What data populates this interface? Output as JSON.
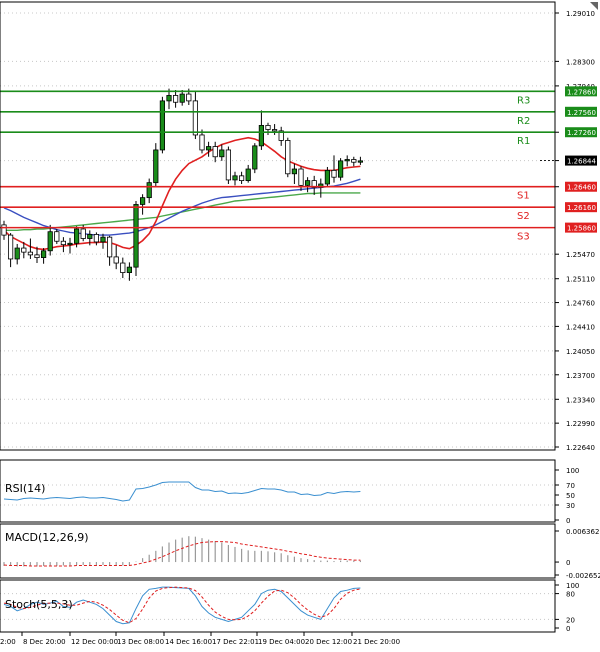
{
  "chart_data": [
    {
      "type": "candlestick",
      "panel": "price",
      "y_ticks": [
        "1.29010",
        "1.28300",
        "1.27940",
        "1.27260",
        "1.26844",
        "1.26460",
        "1.25470",
        "1.25110",
        "1.24760",
        "1.24410",
        "1.24050",
        "1.23700",
        "1.23340",
        "1.22990",
        "1.22640"
      ],
      "levels": [
        {
          "label": "R3",
          "value": 1.2786,
          "tag": "1.27860",
          "color": "#1a8c1a"
        },
        {
          "label": "R2",
          "value": 1.2756,
          "tag": "1.27560",
          "color": "#1a8c1a"
        },
        {
          "label": "R1",
          "value": 1.2726,
          "tag": "1.27260",
          "color": "#1a8c1a"
        },
        {
          "label": "S1",
          "value": 1.2646,
          "tag": "1.26460",
          "color": "#e02020"
        },
        {
          "label": "S2",
          "value": 1.2616,
          "tag": "1.26160",
          "color": "#e02020"
        },
        {
          "label": "S3",
          "value": 1.2586,
          "tag": "1.25860",
          "color": "#e02020"
        }
      ],
      "current_price": {
        "value": 1.26844,
        "tag": "1.26844"
      },
      "candles": [
        [
          1.259,
          1.2596,
          1.2568,
          1.2575
        ],
        [
          1.2575,
          1.2578,
          1.2528,
          1.254
        ],
        [
          1.254,
          1.2562,
          1.2532,
          1.2556
        ],
        [
          1.2556,
          1.2565,
          1.2541,
          1.255
        ],
        [
          1.255,
          1.257,
          1.254,
          1.2546
        ],
        [
          1.2546,
          1.2558,
          1.2534,
          1.2542
        ],
        [
          1.2542,
          1.2556,
          1.2533,
          1.2552
        ],
        [
          1.2552,
          1.259,
          1.2545,
          1.258
        ],
        [
          1.258,
          1.2584,
          1.2562,
          1.2566
        ],
        [
          1.2566,
          1.2572,
          1.255,
          1.2561
        ],
        [
          1.2561,
          1.2571,
          1.2548,
          1.2563
        ],
        [
          1.2563,
          1.2588,
          1.2557,
          1.2584
        ],
        [
          1.2584,
          1.259,
          1.2566,
          1.257
        ],
        [
          1.257,
          1.2582,
          1.256,
          1.2576
        ],
        [
          1.2576,
          1.2579,
          1.256,
          1.2565
        ],
        [
          1.2565,
          1.2577,
          1.2555,
          1.2572
        ],
        [
          1.2572,
          1.2574,
          1.253,
          1.2543
        ],
        [
          1.2543,
          1.256,
          1.2525,
          1.2534
        ],
        [
          1.2534,
          1.2542,
          1.2512,
          1.252
        ],
        [
          1.252,
          1.2535,
          1.2508,
          1.2528
        ],
        [
          1.2528,
          1.2625,
          1.2515,
          1.262
        ],
        [
          1.262,
          1.2635,
          1.2605,
          1.263
        ],
        [
          1.263,
          1.2658,
          1.2622,
          1.2652
        ],
        [
          1.2652,
          1.271,
          1.2645,
          1.27
        ],
        [
          1.27,
          1.2778,
          1.2695,
          1.2772
        ],
        [
          1.2772,
          1.279,
          1.276,
          1.278
        ],
        [
          1.278,
          1.2788,
          1.2762,
          1.277
        ],
        [
          1.277,
          1.2788,
          1.2765,
          1.2782
        ],
        [
          1.2782,
          1.279,
          1.2766,
          1.2772
        ],
        [
          1.2772,
          1.2785,
          1.2716,
          1.2722
        ],
        [
          1.2722,
          1.273,
          1.2695,
          1.27
        ],
        [
          1.27,
          1.2712,
          1.269,
          1.2705
        ],
        [
          1.2705,
          1.2712,
          1.2682,
          1.269
        ],
        [
          1.269,
          1.2708,
          1.2684,
          1.27
        ],
        [
          1.27,
          1.2705,
          1.265,
          1.2656
        ],
        [
          1.2656,
          1.2668,
          1.2648,
          1.2662
        ],
        [
          1.2662,
          1.2668,
          1.265,
          1.2655
        ],
        [
          1.2655,
          1.2678,
          1.2652,
          1.2672
        ],
        [
          1.2672,
          1.271,
          1.2666,
          1.2706
        ],
        [
          1.2706,
          1.2758,
          1.27,
          1.2736
        ],
        [
          1.2736,
          1.274,
          1.2722,
          1.273
        ],
        [
          1.273,
          1.2738,
          1.2722,
          1.2728
        ],
        [
          1.2728,
          1.2734,
          1.2706,
          1.2714
        ],
        [
          1.2714,
          1.2718,
          1.266,
          1.2665
        ],
        [
          1.2665,
          1.268,
          1.265,
          1.2672
        ],
        [
          1.2672,
          1.2676,
          1.264,
          1.2648
        ],
        [
          1.2648,
          1.266,
          1.2638,
          1.2655
        ],
        [
          1.2655,
          1.2662,
          1.2634,
          1.2645
        ],
        [
          1.2645,
          1.2658,
          1.263,
          1.265
        ],
        [
          1.265,
          1.2675,
          1.2645,
          1.267
        ],
        [
          1.267,
          1.2692,
          1.2652,
          1.266
        ],
        [
          1.266,
          1.2688,
          1.2655,
          1.2684
        ],
        [
          1.2684,
          1.2692,
          1.2676,
          1.2686
        ],
        [
          1.2686,
          1.269,
          1.2676,
          1.2682
        ],
        [
          1.2682,
          1.269,
          1.2678,
          1.2684
        ]
      ],
      "ma_red": [
        1.2582,
        1.2573,
        1.2568,
        1.2563,
        1.2558,
        1.2555,
        1.2554,
        1.2556,
        1.2558,
        1.2559,
        1.256,
        1.2562,
        1.2563,
        1.2564,
        1.2564,
        1.2565,
        1.2564,
        1.2561,
        1.2557,
        1.2555,
        1.256,
        1.2567,
        1.2577,
        1.2595,
        1.2618,
        1.264,
        1.2657,
        1.267,
        1.268,
        1.2685,
        1.269,
        1.2697,
        1.2703,
        1.2708,
        1.2711,
        1.2714,
        1.2716,
        1.2718,
        1.2716,
        1.2712,
        1.2705,
        1.2698,
        1.269,
        1.2684,
        1.268,
        1.2676,
        1.2673,
        1.2671,
        1.267,
        1.267,
        1.267,
        1.2672,
        1.2674,
        1.2675,
        1.2676
      ],
      "ma_blue": [
        1.2615,
        1.2611,
        1.2606,
        1.2601,
        1.2597,
        1.2593,
        1.2589,
        1.2586,
        1.2583,
        1.2581,
        1.2579,
        1.2578,
        1.2577,
        1.2576,
        1.2575,
        1.2575,
        1.2575,
        1.2576,
        1.2577,
        1.2578,
        1.258,
        1.2583,
        1.2586,
        1.259,
        1.2595,
        1.26,
        1.2605,
        1.261,
        1.2614,
        1.2618,
        1.2622,
        1.2625,
        1.2628,
        1.263,
        1.2631,
        1.2632,
        1.2633,
        1.2634,
        1.2635,
        1.2636,
        1.2637,
        1.2638,
        1.2639,
        1.264,
        1.2641,
        1.2642,
        1.2643,
        1.2644,
        1.2645,
        1.2646,
        1.2647,
        1.2649,
        1.2651,
        1.2654,
        1.2657
      ],
      "ma_green": [
        1.2582,
        1.2582,
        1.2582,
        1.2583,
        1.2583,
        1.2584,
        1.2584,
        1.2585,
        1.2586,
        1.2587,
        1.2588,
        1.2589,
        1.259,
        1.2591,
        1.2592,
        1.2593,
        1.2594,
        1.2595,
        1.2596,
        1.2597,
        1.2598,
        1.2599,
        1.26,
        1.2601,
        1.2603,
        1.2605,
        1.2607,
        1.2609,
        1.2611,
        1.2613,
        1.2615,
        1.2617,
        1.2619,
        1.2621,
        1.2623,
        1.2625,
        1.2626,
        1.2627,
        1.2628,
        1.2629,
        1.263,
        1.2631,
        1.2632,
        1.2633,
        1.2634,
        1.2635,
        1.2636,
        1.2636,
        1.2637,
        1.2637,
        1.2637,
        1.2637,
        1.2637,
        1.2637,
        1.2637
      ]
    },
    {
      "type": "line",
      "panel": "rsi",
      "name": "RSI(14)",
      "y_ticks": [
        "100",
        "70",
        "50",
        "30",
        "0"
      ],
      "ylim": [
        0,
        100
      ],
      "values": [
        42,
        41,
        40,
        43,
        44,
        43,
        42,
        44,
        45,
        44,
        43,
        45,
        46,
        44,
        44,
        45,
        43,
        41,
        38,
        40,
        62,
        63,
        66,
        70,
        75,
        76,
        76,
        76,
        76,
        65,
        60,
        60,
        57,
        58,
        53,
        54,
        53,
        55,
        59,
        63,
        62,
        62,
        60,
        56,
        56,
        51,
        52,
        49,
        50,
        55,
        53,
        56,
        57,
        56,
        57
      ]
    },
    {
      "type": "bar",
      "panel": "macd",
      "name": "MACD(12,26,9)",
      "y_ticks": [
        "0.006362",
        "0",
        "-0.002652"
      ],
      "ylim": [
        -0.002652,
        0.006362
      ],
      "values": [
        -0.0008,
        -0.0008,
        -0.0009,
        -0.0009,
        -0.0009,
        -0.0009,
        -0.0008,
        -0.0008,
        -0.0008,
        -0.0007,
        -0.0007,
        -0.0006,
        -0.0006,
        -0.0006,
        -0.0006,
        -0.0006,
        -0.0006,
        -0.0007,
        -0.0007,
        -0.0006,
        0.0001,
        0.0008,
        0.0015,
        0.0023,
        0.0032,
        0.004,
        0.0046,
        0.005,
        0.0053,
        0.0052,
        0.0049,
        0.0046,
        0.0043,
        0.004,
        0.0035,
        0.0031,
        0.0027,
        0.0024,
        0.0023,
        0.0023,
        0.0022,
        0.002,
        0.0018,
        0.0014,
        0.0011,
        0.0008,
        0.0006,
        0.0004,
        0.0003,
        0.0003,
        0.0002,
        0.0003,
        0.0003,
        0.0003,
        0.0003
      ],
      "signal": [
        -0.0006,
        -0.0007,
        -0.0007,
        -0.0007,
        -0.0008,
        -0.0008,
        -0.0008,
        -0.0008,
        -0.0008,
        -0.0008,
        -0.0008,
        -0.0007,
        -0.0007,
        -0.0007,
        -0.0007,
        -0.0007,
        -0.0007,
        -0.0007,
        -0.0007,
        -0.0007,
        -0.0005,
        -0.0002,
        0.0001,
        0.0006,
        0.0011,
        0.0017,
        0.0023,
        0.0028,
        0.0033,
        0.0037,
        0.004,
        0.0041,
        0.0042,
        0.0042,
        0.0041,
        0.004,
        0.0037,
        0.0035,
        0.0033,
        0.0031,
        0.0029,
        0.0027,
        0.0025,
        0.0022,
        0.002,
        0.0017,
        0.0015,
        0.0012,
        0.001,
        0.0008,
        0.0007,
        0.0006,
        0.0005,
        0.0004,
        0.0004
      ]
    },
    {
      "type": "line",
      "panel": "stoch",
      "name": "Stoch(5,5,3)",
      "y_ticks": [
        "100",
        "80",
        "20",
        "0"
      ],
      "ylim": [
        0,
        100
      ],
      "main": [
        55,
        50,
        40,
        45,
        55,
        60,
        55,
        58,
        62,
        50,
        48,
        60,
        65,
        60,
        55,
        45,
        30,
        15,
        10,
        12,
        45,
        75,
        90,
        92,
        95,
        95,
        94,
        93,
        92,
        75,
        50,
        35,
        25,
        20,
        15,
        20,
        25,
        40,
        55,
        80,
        88,
        90,
        85,
        70,
        55,
        40,
        30,
        25,
        20,
        45,
        70,
        85,
        88,
        92,
        93
      ],
      "signal": [
        58,
        55,
        48,
        45,
        48,
        53,
        57,
        58,
        58,
        56,
        53,
        53,
        58,
        62,
        60,
        53,
        43,
        30,
        18,
        12,
        22,
        44,
        70,
        86,
        92,
        94,
        95,
        94,
        93,
        87,
        72,
        53,
        37,
        27,
        20,
        19,
        20,
        28,
        40,
        58,
        74,
        86,
        88,
        82,
        70,
        55,
        42,
        32,
        25,
        30,
        45,
        67,
        81,
        88,
        91
      ]
    }
  ],
  "x_axis": {
    "labels": [
      "8 Dec 20:00",
      "12 Dec 00:00",
      "13 Dec 08:00",
      "14 Dec 16:00",
      "17 Dec 22:01",
      "19 Dec 04:00",
      "20 Dec 12:00",
      "21 Dec 20:00"
    ],
    "first_label_partial": "2:00"
  },
  "colors": {
    "bull": "#1a8c1a",
    "bear": "#e02020",
    "wick": "#000000",
    "ma_red": "#e02020",
    "ma_blue": "#3a4fc0",
    "ma_green": "#4aa84a",
    "indicator": "#3a8fd0",
    "signal": "#e02020",
    "grid": "#c8c8c8",
    "frame": "#000000"
  }
}
